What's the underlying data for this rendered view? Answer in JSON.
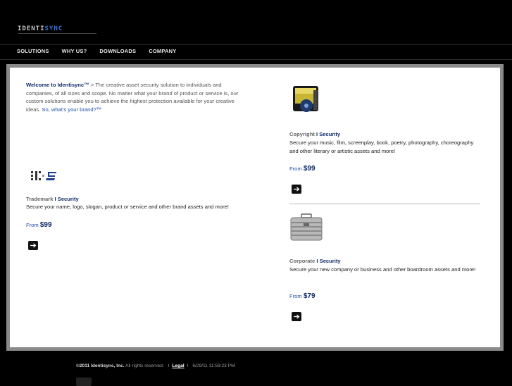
{
  "brand": {
    "logo_part1": "IDENTI",
    "logo_part2": "SYNC"
  },
  "nav": {
    "items": [
      "SOLUTIONS",
      "WHY US?",
      "DOWNLOADS",
      "COMPANY"
    ]
  },
  "welcome": {
    "bold": "Welcome to Identisync™",
    "body": " > The creative asset security solution to individuals and companies, of all sizes and scope. No matter what your brand of product or service is, our custom solutions enable you to achieve the highest protection available for your creative ideas. ",
    "question": "So, what's your brand?™"
  },
  "trademark": {
    "title": "Trademark ",
    "security": "I Security",
    "desc": "Secure your name, logo, slogan, product or service and other brand assets and more!",
    "from": "From ",
    "price": "$99"
  },
  "copyright": {
    "title": "Copyright ",
    "security": "I Security",
    "desc": "Secure your music, film, screenplay, book, poetry, photography, choreography and other literary or artistic assets and more!",
    "from": "From ",
    "price": "$99"
  },
  "corporate": {
    "title": "Corporate ",
    "security": "I Security",
    "desc": "Secure your new company or business and other boardroom assets and more!",
    "from": "From ",
    "price": "$79"
  },
  "footer": {
    "copyright": "©2011 Identisync, Inc.",
    "rights": " All rights reserved.",
    "legal": "Legal",
    "timestamp": "6/29/11 11:59:23 PM"
  },
  "icons": [
    "arrow-right-icon",
    "trademark-logo-icon",
    "copyright-media-icon",
    "briefcase-icon",
    "facebook-icon"
  ]
}
